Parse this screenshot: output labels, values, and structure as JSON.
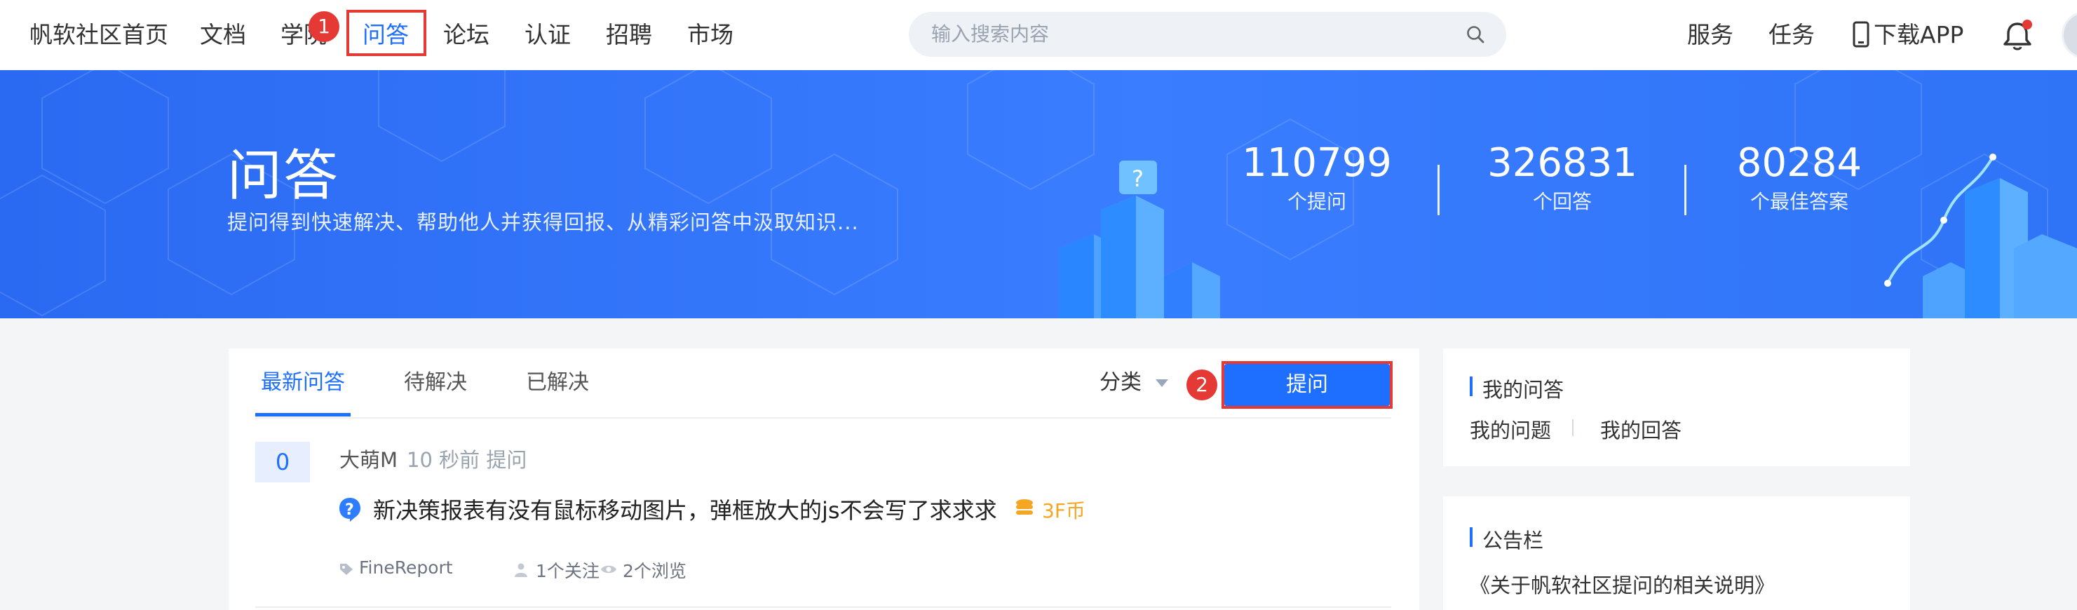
{
  "nav": {
    "items": [
      "帆软社区首页",
      "文档",
      "学院",
      "问答",
      "论坛",
      "认证",
      "招聘",
      "市场"
    ],
    "active": "问答",
    "search_placeholder": "输入搜索内容",
    "right": {
      "service": "服务",
      "task": "任务",
      "download": "下载APP"
    },
    "step_badge": "1"
  },
  "banner": {
    "title": "问答",
    "subtitle": "提问得到快速解决、帮助他人并获得回报、从精彩问答中汲取知识...",
    "stats": [
      {
        "value": "110799",
        "label": "个提问"
      },
      {
        "value": "326831",
        "label": "个回答"
      },
      {
        "value": "80284",
        "label": "个最佳答案"
      }
    ]
  },
  "main": {
    "tabs": [
      "最新问答",
      "待解决",
      "已解决"
    ],
    "active_tab": "最新问答",
    "category_label": "分类",
    "step_badge": "2",
    "ask_button": "提问",
    "questions": [
      {
        "answer_count": "0",
        "author": "大萌M",
        "time": "10 秒前 提问",
        "title": "新决策报表有没有鼠标移动图片，弹框放大的js不会写了求求求",
        "reward": "3F币",
        "tag": "FineReport",
        "follows": "1个关注",
        "views": "2个浏览"
      }
    ]
  },
  "sidebar": {
    "my_qa": {
      "title": "我的问答",
      "links": [
        "我的问题",
        "我的回答"
      ]
    },
    "notice": {
      "title": "公告栏",
      "items": [
        "《关于帆软社区提问的相关说明》"
      ]
    }
  },
  "colors": {
    "accent": "#1e6fff",
    "highlight": "#e53935",
    "reward": "#f5a623",
    "banner": "#3a7dff"
  }
}
